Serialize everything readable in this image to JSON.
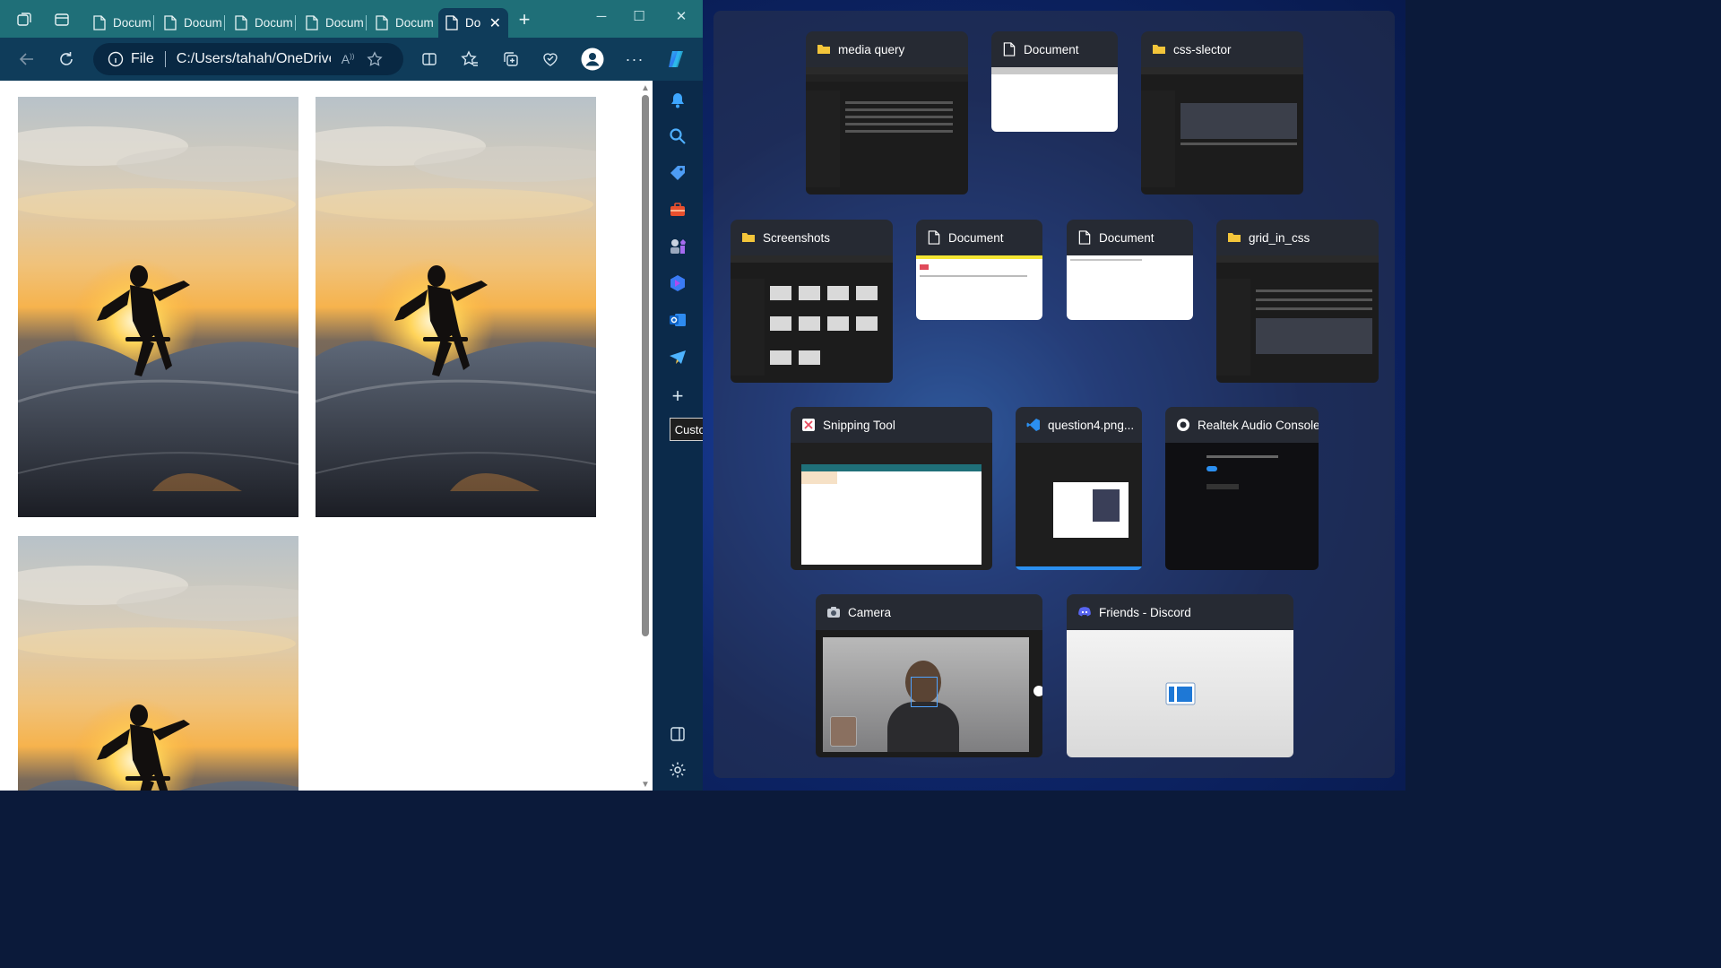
{
  "browser": {
    "tabs": [
      {
        "label": "Docum"
      },
      {
        "label": "Docum"
      },
      {
        "label": "Docum"
      },
      {
        "label": "Docum"
      },
      {
        "label": "Docum"
      },
      {
        "label": "Do",
        "active": true
      }
    ],
    "address": {
      "file_label": "File",
      "url": "C:/Users/tahah/OneDrive..."
    },
    "images_shown": 3,
    "sidebar": {
      "tooltip": "Customize",
      "icons": [
        "notifications-icon",
        "search-icon",
        "shopping-tag-icon",
        "tools-briefcase-icon",
        "games-icon",
        "copilot-app-icon",
        "outlook-icon",
        "telegram-plane-icon",
        "add-icon",
        "split-pane-icon",
        "settings-gear-icon"
      ]
    }
  },
  "task_view": {
    "windows": [
      {
        "title": "media query",
        "icon": "folder-icon"
      },
      {
        "title": "Document",
        "icon": "document-icon"
      },
      {
        "title": "css-slector",
        "icon": "folder-icon"
      },
      {
        "title": "Screenshots",
        "icon": "folder-icon"
      },
      {
        "title": "Document",
        "icon": "document-icon"
      },
      {
        "title": "Document",
        "icon": "document-icon"
      },
      {
        "title": "grid_in_css",
        "icon": "folder-icon"
      },
      {
        "title": "Snipping Tool",
        "icon": "snipping-tool-icon"
      },
      {
        "title": "question4.png...",
        "icon": "vscode-icon"
      },
      {
        "title": "Realtek Audio Console",
        "icon": "realtek-icon"
      },
      {
        "title": "Camera",
        "icon": "camera-icon"
      },
      {
        "title": "Friends - Discord",
        "icon": "discord-icon"
      }
    ]
  },
  "colors": {
    "tabbar": "#1f6f78",
    "toolbar": "#0f3c5a",
    "folder": "#f3c53a",
    "vscode": "#2b8ff0",
    "discord": "#5865f2"
  }
}
